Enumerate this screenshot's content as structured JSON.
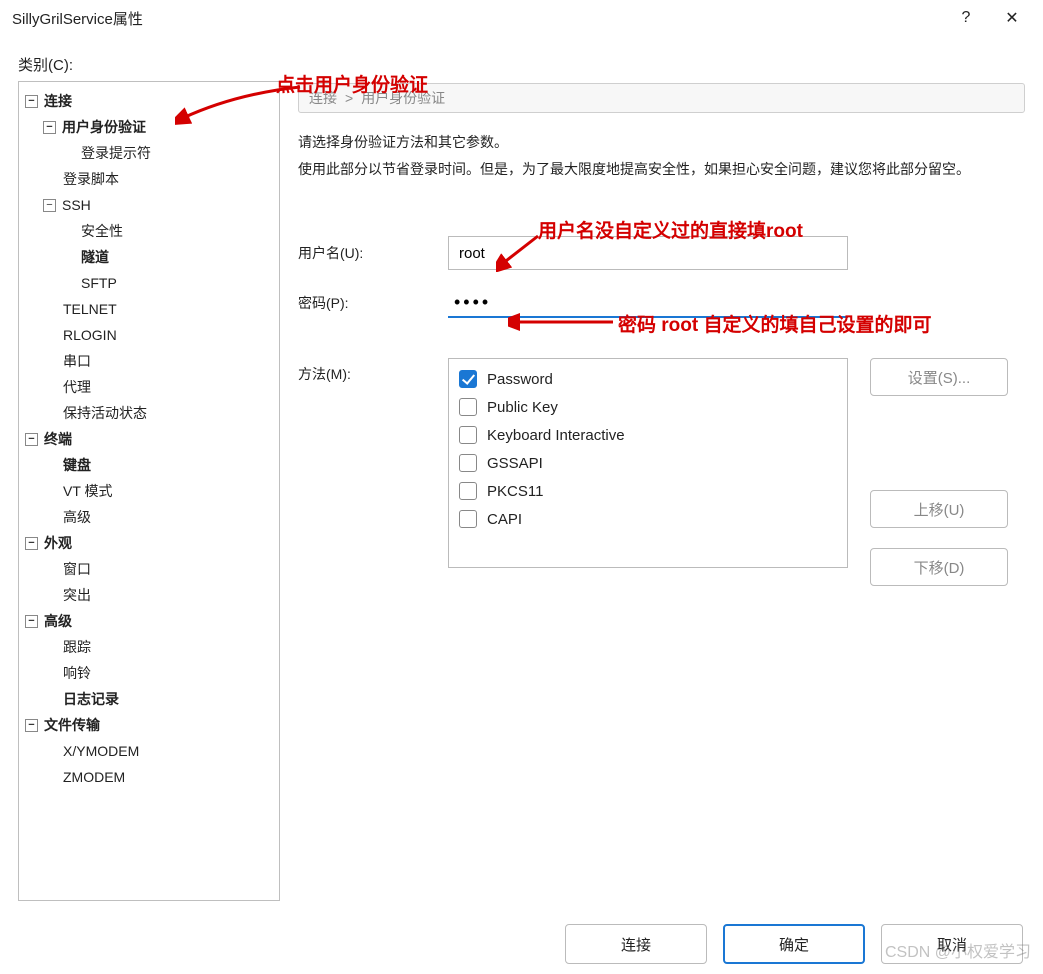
{
  "title": "SillyGrilService属性",
  "help_icon": "?",
  "close_icon": "✕",
  "category_label": "类别(C):",
  "tree": {
    "connection": "连接",
    "user_auth": "用户身份验证",
    "login_prompt": "登录提示符",
    "login_script": "登录脚本",
    "ssh": "SSH",
    "security": "安全性",
    "tunnel": "隧道",
    "sftp": "SFTP",
    "telnet": "TELNET",
    "rlogin": "RLOGIN",
    "serial": "串口",
    "proxy": "代理",
    "keepalive": "保持活动状态",
    "terminal": "终端",
    "keyboard": "键盘",
    "vtmode": "VT 模式",
    "advanced_t": "高级",
    "appearance": "外观",
    "window": "窗口",
    "highlight": "突出",
    "advanced": "高级",
    "trace": "跟踪",
    "bell": "响铃",
    "logging": "日志记录",
    "filetrans": "文件传输",
    "xymodem": "X/YMODEM",
    "zmodem": "ZMODEM"
  },
  "breadcrumb": {
    "a": "连接",
    "sep": ">",
    "b": "用户身份验证"
  },
  "desc_line1": "请选择身份验证方法和其它参数。",
  "desc_line2": "使用此部分以节省登录时间。但是，为了最大限度地提高安全性，如果担心安全问题，建议您将此部分留空。",
  "username_label": "用户名(U):",
  "username_value": "root",
  "password_label": "密码(P):",
  "password_mask": "••••",
  "method_label": "方法(M):",
  "methods": {
    "password": "Password",
    "publickey": "Public Key",
    "kbdint": "Keyboard Interactive",
    "gssapi": "GSSAPI",
    "pkcs11": "PKCS11",
    "capi": "CAPI"
  },
  "btn_settings": "设置(S)...",
  "btn_up": "上移(U)",
  "btn_down": "下移(D)",
  "btn_connect": "连接",
  "btn_ok": "确定",
  "btn_cancel": "取消",
  "anno": {
    "a1": "点击用户身份验证",
    "a2": "用户名没自定义过的直接填root",
    "a3": "密码 root 自定义的填自己设置的即可"
  },
  "watermark": "CSDN @小权爱学习"
}
